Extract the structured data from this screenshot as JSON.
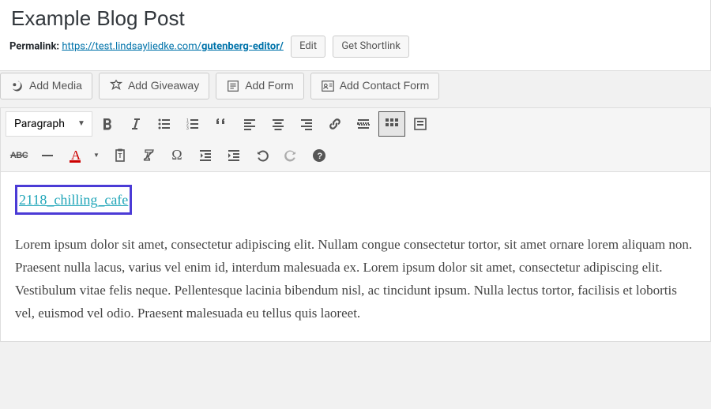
{
  "title": {
    "value": "Example Blog Post"
  },
  "permalink": {
    "label": "Permalink:",
    "url_prefix": "https://test.lindsayliedke.com/",
    "slug": "gutenberg-editor/",
    "edit": "Edit",
    "shortlink": "Get Shortlink"
  },
  "media_buttons": {
    "add_media": "Add Media",
    "add_giveaway": "Add Giveaway",
    "add_form": "Add Form",
    "add_contact_form": "Add Contact Form"
  },
  "toolbar": {
    "format": "Paragraph"
  },
  "content": {
    "link_text": "2118_chilling_cafe",
    "paragraph": "Lorem ipsum dolor sit amet, consectetur adipiscing elit. Nullam congue consectetur tortor, sit amet ornare lorem aliquam non. Praesent nulla lacus, varius vel enim id, interdum malesuada ex. Lorem ipsum dolor sit amet, consectetur adipiscing elit. Vestibulum vitae felis neque. Pellentesque lacinia bibendum nisl, ac tincidunt ipsum. Nulla lectus tortor, facilisis et lobortis vel, euismod vel odio. Praesent malesuada eu tellus quis laoreet."
  }
}
